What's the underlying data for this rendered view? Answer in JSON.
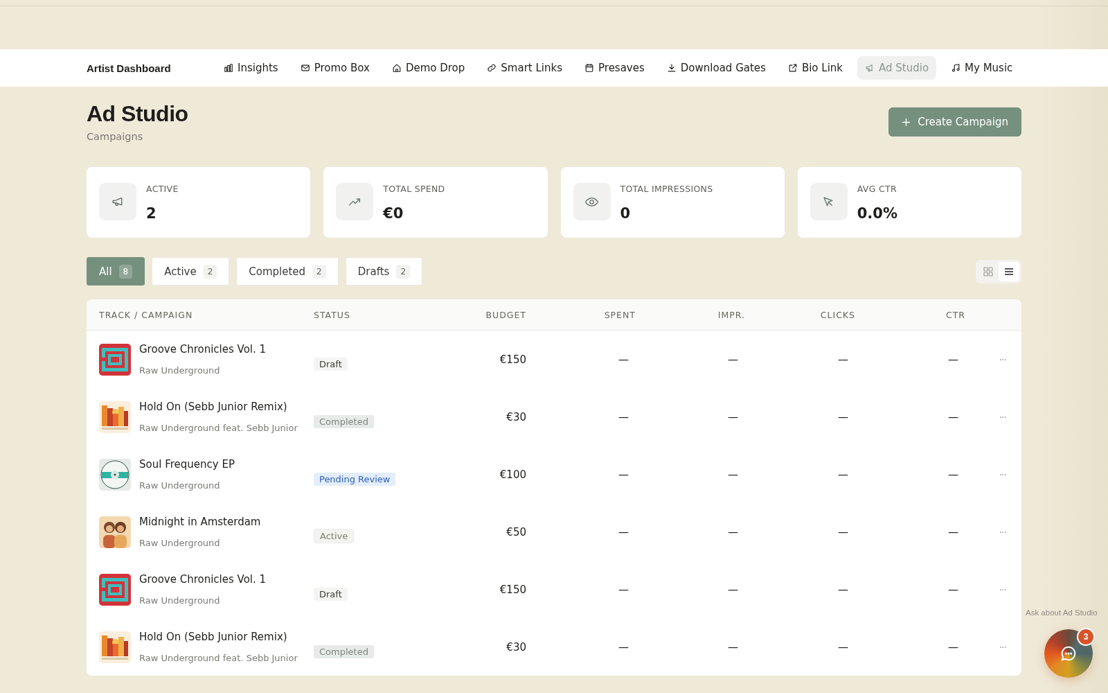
{
  "nav": {
    "brand": "Artist Dashboard",
    "items": [
      {
        "label": "Insights",
        "selected": false
      },
      {
        "label": "Promo Box",
        "selected": false
      },
      {
        "label": "Demo Drop",
        "selected": false
      },
      {
        "label": "Smart Links",
        "selected": false
      },
      {
        "label": "Presaves",
        "selected": false
      },
      {
        "label": "Download Gates",
        "selected": false
      },
      {
        "label": "Bio Link",
        "selected": false
      },
      {
        "label": "Ad Studio",
        "selected": true
      },
      {
        "label": "My Music",
        "selected": false
      }
    ]
  },
  "header": {
    "title": "Ad Studio",
    "subtitle": "Campaigns",
    "button": "Create Campaign"
  },
  "stats": [
    {
      "label": "ACTIVE",
      "value": "2"
    },
    {
      "label": "TOTAL SPEND",
      "value": "€0"
    },
    {
      "label": "TOTAL IMPRESSIONS",
      "value": "0"
    },
    {
      "label": "AVG CTR",
      "value": "0.0%"
    }
  ],
  "filters": [
    {
      "label": "All",
      "count": "8",
      "selected": true
    },
    {
      "label": "Active",
      "count": "2",
      "selected": false
    },
    {
      "label": "Completed",
      "count": "2",
      "selected": false
    },
    {
      "label": "Drafts",
      "count": "2",
      "selected": false
    }
  ],
  "view_toggle": [
    {
      "kind": "grid",
      "selected": false
    },
    {
      "kind": "list",
      "selected": true
    }
  ],
  "table": {
    "columns": [
      "TRACK / CAMPAIGN",
      "STATUS",
      "BUDGET",
      "SPENT",
      "IMPR.",
      "CLICKS",
      "CTR"
    ],
    "rows": [
      {
        "title": "Groove Chronicles Vol. 1",
        "artist": "Raw Underground",
        "status": {
          "label": "Draft",
          "kind": "draft"
        },
        "budget": "€150",
        "spent": "—",
        "impressions": "—",
        "clicks": "—",
        "ctr": "—",
        "menu": "···"
      },
      {
        "title": "Hold On (Sebb Junior Remix)",
        "artist": "Raw Underground feat. Sebb Junior",
        "status": {
          "label": "Completed",
          "kind": "completed"
        },
        "budget": "€30",
        "spent": "—",
        "impressions": "—",
        "clicks": "—",
        "ctr": "—",
        "menu": "···"
      },
      {
        "title": "Soul Frequency EP",
        "artist": "Raw Underground",
        "status": {
          "label": "Pending Review",
          "kind": "pending"
        },
        "budget": "€100",
        "spent": "—",
        "impressions": "—",
        "clicks": "—",
        "ctr": "—",
        "menu": "···"
      },
      {
        "title": "Midnight in Amsterdam",
        "artist": "Raw Underground",
        "status": {
          "label": "Active",
          "kind": "active"
        },
        "budget": "€50",
        "spent": "—",
        "impressions": "—",
        "clicks": "—",
        "ctr": "—",
        "menu": "···"
      },
      {
        "title": "Groove Chronicles Vol. 1",
        "artist": "Raw Underground",
        "status": {
          "label": "Draft",
          "kind": "draft"
        },
        "budget": "€150",
        "spent": "—",
        "impressions": "—",
        "clicks": "—",
        "ctr": "—",
        "menu": "···"
      },
      {
        "title": "Hold On (Sebb Junior Remix)",
        "artist": "Raw Underground feat. Sebb Junior",
        "status": {
          "label": "Completed",
          "kind": "completed"
        },
        "budget": "€30",
        "spent": "—",
        "impressions": "—",
        "clicks": "—",
        "ctr": "—",
        "menu": "···"
      }
    ]
  },
  "assistant": {
    "hint": "Ask about Ad Studio",
    "badge": "3"
  }
}
